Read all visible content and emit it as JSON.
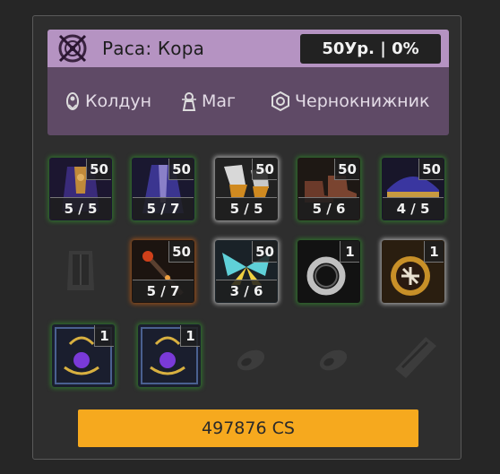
{
  "race": {
    "label": "Раса: Кора",
    "level_text": "50Ур. | 0%",
    "classes": [
      {
        "name": "Колдун",
        "icon": "warlock-class-icon"
      },
      {
        "name": "Маг",
        "icon": "mage-class-icon"
      },
      {
        "name": "Чернокнижник",
        "icon": "necromancer-class-icon"
      }
    ]
  },
  "items": [
    {
      "icon": "robe-armor-icon",
      "level": "50",
      "count": "5 / 5",
      "quality": "green"
    },
    {
      "icon": "cloak-pants-icon",
      "level": "50",
      "count": "5 / 7",
      "quality": "green"
    },
    {
      "icon": "gauntlets-icon",
      "level": "50",
      "count": "5 / 5",
      "quality": "white"
    },
    {
      "icon": "boots-icon",
      "level": "50",
      "count": "5 / 6",
      "quality": "green"
    },
    {
      "icon": "hat-icon",
      "level": "50",
      "count": "4 / 5",
      "quality": "green"
    },
    {
      "icon": "empty-chest-slot-icon",
      "level": "",
      "count": "",
      "quality": "empty"
    },
    {
      "icon": "staff-weapon-icon",
      "level": "50",
      "count": "5 / 7",
      "quality": "orange"
    },
    {
      "icon": "wings-icon",
      "level": "50",
      "count": "3 / 6",
      "quality": "white"
    },
    {
      "icon": "ring-icon",
      "level": "1",
      "count": "",
      "quality": "green"
    },
    {
      "icon": "amulet-icon",
      "level": "1",
      "count": "",
      "quality": "white"
    },
    {
      "icon": "purple-brooch-icon",
      "level": "1",
      "count": "",
      "quality": "green"
    },
    {
      "icon": "purple-brooch-icon",
      "level": "1",
      "count": "",
      "quality": "green"
    },
    {
      "icon": "empty-earring-slot-icon",
      "level": "",
      "count": "",
      "quality": "empty"
    },
    {
      "icon": "empty-earring-slot-icon",
      "level": "",
      "count": "",
      "quality": "empty"
    },
    {
      "icon": "empty-bracer-slot-icon",
      "level": "",
      "count": "",
      "quality": "empty"
    }
  ],
  "cost": {
    "label": "497876 CS"
  },
  "colors": {
    "accent": "#f6a91e",
    "race_header": "#b593c2",
    "race_body": "#5f4a66"
  }
}
